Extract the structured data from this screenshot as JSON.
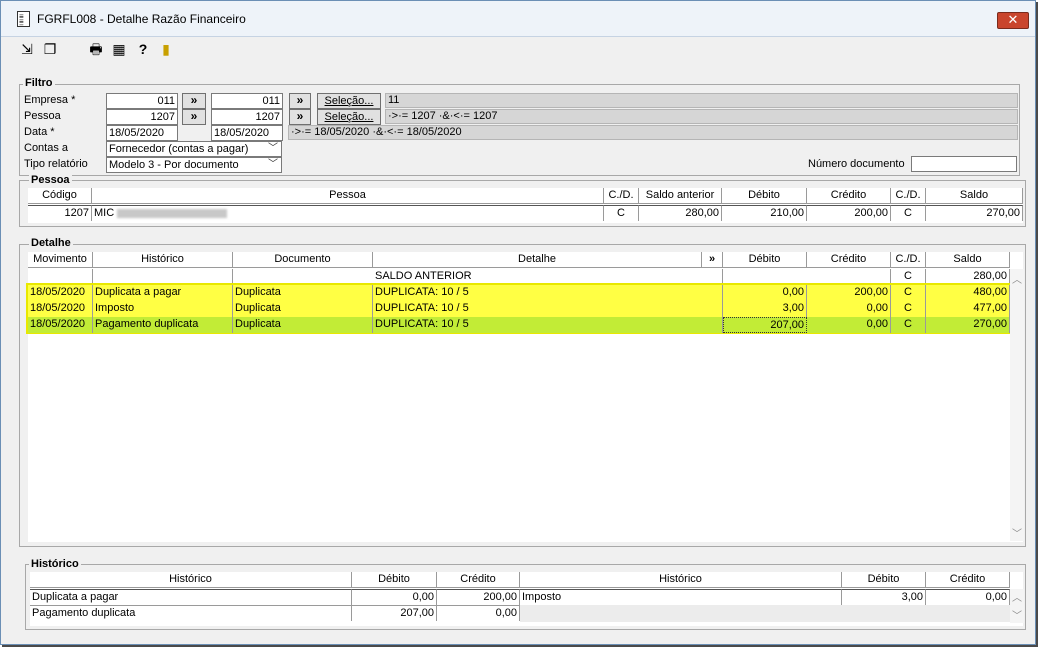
{
  "window": {
    "title": "FGRFL008 - Detalhe Razão Financeiro",
    "close_label": "✕"
  },
  "toolbar": {
    "icons": [
      "arrow-in-icon",
      "cascade-icon",
      "print-icon",
      "grid-icon",
      "help-icon",
      "exit-door-icon"
    ],
    "glyphs": [
      "⇲",
      "❐",
      "🖶",
      "▦",
      "?",
      "▮"
    ]
  },
  "filtro": {
    "title": "Filtro",
    "empresa_label": "Empresa *",
    "empresa_from": "011",
    "empresa_to": "011",
    "pessoa_label": "Pessoa",
    "pessoa_from": "1207",
    "pessoa_to": "1207",
    "data_label": "Data *",
    "data_from": "18/05/2020",
    "data_to": "18/05/2020",
    "contas_label": "Contas a",
    "contas_value": "Fornecedor (contas a pagar)",
    "tipo_label": "Tipo relatório",
    "tipo_value": "Modelo 3 - Por documento",
    "numero_doc_label": "Número documento",
    "numero_doc_value": "",
    "chevron": "»",
    "selecao_label": "Seleção...",
    "empresa_sel": "11",
    "pessoa_sel": "·>·= 1207 ·&·<·= 1207",
    "data_sel": "·>·= 18/05/2020 ·&·<·= 18/05/2020"
  },
  "pessoa": {
    "title": "Pessoa",
    "headers": [
      "Código",
      "Pessoa",
      "C./D.",
      "Saldo anterior",
      "Débito",
      "Crédito",
      "C./D.",
      "Saldo"
    ],
    "row": {
      "codigo": "1207",
      "nome": "MIC",
      "cd": "C",
      "saldo_anterior": "280,00",
      "debito": "210,00",
      "credito": "200,00",
      "cd2": "C",
      "saldo": "270,00"
    }
  },
  "detalhe": {
    "title": "Detalhe",
    "headers": [
      "Movimento",
      "Histórico",
      "Documento",
      "Detalhe",
      "»",
      "Débito",
      "Crédito",
      "C./D.",
      "Saldo"
    ],
    "saldo_anterior": {
      "detalhe": "SALDO ANTERIOR",
      "cd": "C",
      "saldo": "280,00"
    },
    "rows": [
      {
        "movimento": "18/05/2020",
        "historico": "Duplicata a pagar",
        "documento": "Duplicata",
        "detalhe": "DUPLICATA: 10 / 5",
        "debito": "0,00",
        "credito": "200,00",
        "cd": "C",
        "saldo": "480,00"
      },
      {
        "movimento": "18/05/2020",
        "historico": "Imposto",
        "documento": "Duplicata",
        "detalhe": "DUPLICATA: 10 / 5",
        "debito": "3,00",
        "credito": "0,00",
        "cd": "C",
        "saldo": "477,00"
      },
      {
        "movimento": "18/05/2020",
        "historico": "Pagamento duplicata",
        "documento": "Duplicata",
        "detalhe": "DUPLICATA: 10 / 5",
        "debito": "207,00",
        "credito": "0,00",
        "cd": "C",
        "saldo": "270,00"
      }
    ],
    "highlight_color": "#ffff44",
    "selected_color": "#c2ec36"
  },
  "historico": {
    "title": "Histórico",
    "headers_left": [
      "Histórico",
      "Débito",
      "Crédito"
    ],
    "headers_right": [
      "Histórico",
      "Débito",
      "Crédito"
    ],
    "left_rows": [
      {
        "historico": "Duplicata a pagar",
        "debito": "0,00",
        "credito": "200,00"
      },
      {
        "historico": "Pagamento duplicata",
        "debito": "207,00",
        "credito": "0,00"
      }
    ],
    "right_rows": [
      {
        "historico": "Imposto",
        "debito": "3,00",
        "credito": "0,00"
      }
    ]
  },
  "scroll": {
    "up": "︿",
    "down": "﹀"
  }
}
